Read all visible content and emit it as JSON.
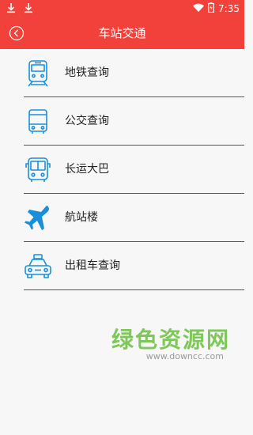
{
  "status_bar": {
    "time": "7:35"
  },
  "header": {
    "title": "车站交通"
  },
  "menu": [
    {
      "label": "地铁查询",
      "icon": "subway-icon"
    },
    {
      "label": "公交查询",
      "icon": "bus-icon"
    },
    {
      "label": "长运大巴",
      "icon": "coach-bus-icon"
    },
    {
      "label": "航站楼",
      "icon": "airplane-icon"
    },
    {
      "label": "出租车查询",
      "icon": "taxi-icon"
    }
  ],
  "watermark": {
    "text": "绿色资源网",
    "url": "www.downcc.com"
  },
  "colors": {
    "accent": "#f2413a",
    "icon": "#1a8fd8",
    "watermark": "#7ec85a"
  }
}
